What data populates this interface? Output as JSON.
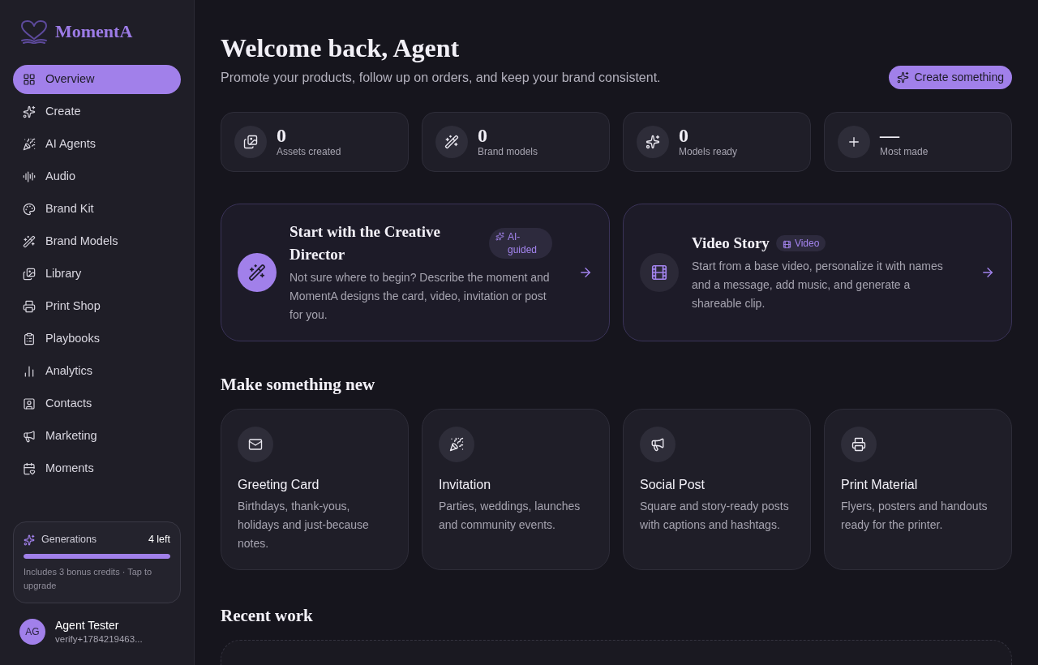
{
  "sidebar": {
    "logo": "MomentA",
    "nav": [
      {
        "label": "Overview",
        "selected": true
      },
      {
        "label": "Create",
        "selected": false
      },
      {
        "label": "AI Agents",
        "selected": false
      },
      {
        "label": "Audio",
        "selected": false
      },
      {
        "label": "Brand Kit",
        "selected": false
      },
      {
        "label": "Brand Models",
        "selected": false
      },
      {
        "label": "Library",
        "selected": false
      },
      {
        "label": "Print Shop",
        "selected": false
      },
      {
        "label": "Playbooks",
        "selected": false
      },
      {
        "label": "Analytics",
        "selected": false
      },
      {
        "label": "Contacts",
        "selected": false
      },
      {
        "label": "Marketing",
        "selected": false
      },
      {
        "label": "Moments",
        "selected": false
      }
    ],
    "generations": {
      "label": "Generations",
      "remaining": "4 left",
      "level": 1,
      "note": "Includes 3 bonus credits · Tap to upgrade"
    },
    "user": {
      "initials": "AG",
      "name": "Agent Tester",
      "email": "verify+1784219463..."
    }
  },
  "header": {
    "title": "Welcome back, Agent",
    "subtitle": "Promote your products, follow up on orders, and keep your brand consistent.",
    "action": "Create something"
  },
  "stats": [
    {
      "value": "0",
      "label": "Assets created"
    },
    {
      "value": "0",
      "label": "Brand models"
    },
    {
      "value": "0",
      "label": "Models ready"
    },
    {
      "value": "—",
      "label": "Most made"
    }
  ],
  "featured": [
    {
      "kind": "director",
      "title": "Start with the Creative Director",
      "badge": "AI-guided",
      "description": "Not sure where to begin? Describe the moment and MomentA designs the card, video, invitation or post for you."
    },
    {
      "kind": "video",
      "title": "Video Story",
      "badge": "Video",
      "description": "Start from a base video, personalize it with names and a message, add music, and generate a shareable clip."
    }
  ],
  "make_section": {
    "title": "Make something new",
    "cards": [
      {
        "title": "Greeting Card",
        "description": "Birthdays, thank-yous, holidays and just-because notes."
      },
      {
        "title": "Invitation",
        "description": "Parties, weddings, launches and community events."
      },
      {
        "title": "Social Post",
        "description": "Square and story-ready posts with captions and hashtags."
      },
      {
        "title": "Print Material",
        "description": "Flyers, posters and handouts ready for the printer."
      }
    ]
  },
  "recent_section": {
    "title": "Recent work"
  }
}
